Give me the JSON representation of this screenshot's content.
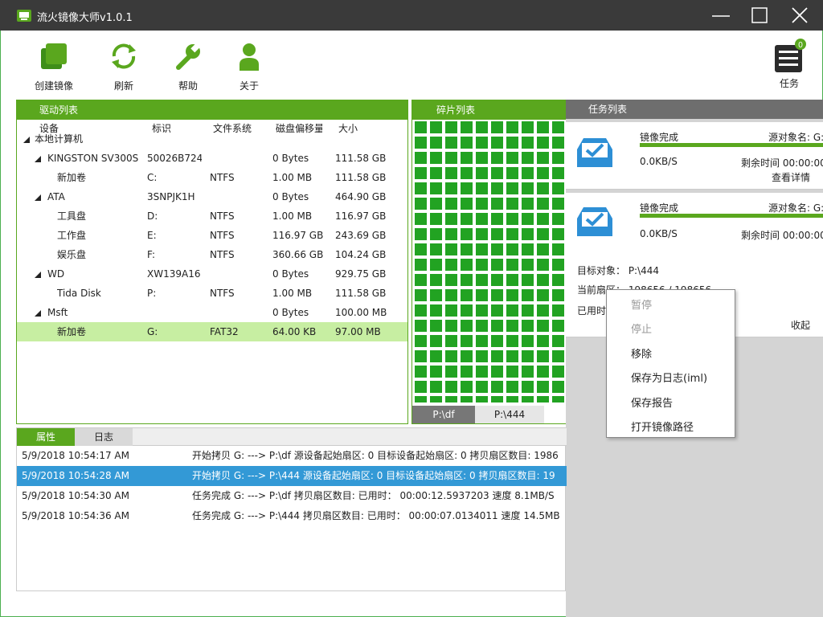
{
  "window": {
    "title": "流火镜像大师v1.0.1"
  },
  "toolbar": {
    "create": "创建镜像",
    "refresh": "刷新",
    "help": "帮助",
    "about": "关于",
    "task": "任务",
    "task_badge": "0"
  },
  "drives": {
    "header": "驱动列表",
    "columns": [
      "设备",
      "标识",
      "文件系统",
      "磁盘偏移量",
      "大小"
    ],
    "root": "本地计算机",
    "rows": [
      {
        "name": "KINGSTON SV300S",
        "id": "50026B724",
        "fs": "",
        "offset": "0 Bytes",
        "size": "111.58 GB"
      },
      {
        "name": "新加卷",
        "id": "C:",
        "fs": "NTFS",
        "offset": "1.00 MB",
        "size": "111.58 GB"
      },
      {
        "name": "ATA",
        "id": "3SNPJK1H",
        "fs": "",
        "offset": "0 Bytes",
        "size": "464.90 GB"
      },
      {
        "name": "工具盘",
        "id": "D:",
        "fs": "NTFS",
        "offset": "1.00 MB",
        "size": "116.97 GB"
      },
      {
        "name": "工作盘",
        "id": "E:",
        "fs": "NTFS",
        "offset": "116.97 GB",
        "size": "243.69 GB"
      },
      {
        "name": "娱乐盘",
        "id": "F:",
        "fs": "NTFS",
        "offset": "360.66 GB",
        "size": "104.24 GB"
      },
      {
        "name": "WD",
        "id": "XW139A16",
        "fs": "",
        "offset": "0 Bytes",
        "size": "929.75 GB"
      },
      {
        "name": "Tida Disk",
        "id": "P:",
        "fs": "NTFS",
        "offset": "1.00 MB",
        "size": "111.58 GB"
      },
      {
        "name": "Msft",
        "id": "",
        "fs": "",
        "offset": "0 Bytes",
        "size": "100.00 MB"
      },
      {
        "name": "新加卷",
        "id": "G:",
        "fs": "FAT32",
        "offset": "64.00 KB",
        "size": "97.00 MB"
      }
    ]
  },
  "fragments": {
    "header": "碎片列表",
    "tabs": [
      "P:\\df",
      "P:\\444"
    ]
  },
  "tasks": {
    "header": "任务列表",
    "cards": [
      {
        "status": "镜像完成",
        "source": "源对象名: G:",
        "speed": "0.0KB/S",
        "remain": "剩余时间 00:00:00",
        "detail": "查看详情"
      },
      {
        "status": "镜像完成",
        "source": "源对象名: G:",
        "speed": "0.0KB/S",
        "remain": "剩余时间 00:00:00"
      }
    ],
    "target": "目标对象：  P:\\444",
    "sector": "当前扇区：  198656 / 198656",
    "elapsed": "已用时",
    "collapse": "收起"
  },
  "bottom": {
    "tabs": [
      "属性",
      "日志"
    ],
    "log": [
      {
        "time": "5/9/2018 10:54:17 AM",
        "msg": "开始拷贝 G: ---> P:\\df   源设备起始扇区: 0   目标设备起始扇区: 0   拷贝扇区数目: 1986"
      },
      {
        "time": "5/9/2018 10:54:28 AM",
        "msg": "开始拷贝 G: ---> P:\\444   源设备起始扇区: 0   目标设备起始扇区: 0   拷贝扇区数目: 19"
      },
      {
        "time": "5/9/2018 10:54:30 AM",
        "msg": "任务完成 G: ---> P:\\df   拷贝扇区数目:    已用时：  00:00:12.5937203    速度 8.1MB/S"
      },
      {
        "time": "5/9/2018 10:54:36 AM",
        "msg": "任务完成 G: ---> P:\\444   拷贝扇区数目:    已用时：  00:00:07.0134011    速度 14.5MB"
      }
    ]
  },
  "context_menu": {
    "items": [
      "暂停",
      "停止",
      "移除",
      "保存为日志(iml)",
      "保存报告",
      "打开镜像路径"
    ],
    "disabled": [
      true,
      true,
      false,
      false,
      false,
      false
    ]
  },
  "colors": {
    "accent": "#5aa71e",
    "titlebar": "#3a3a3a",
    "cell": "#22a322",
    "selection": "#3399d6"
  }
}
